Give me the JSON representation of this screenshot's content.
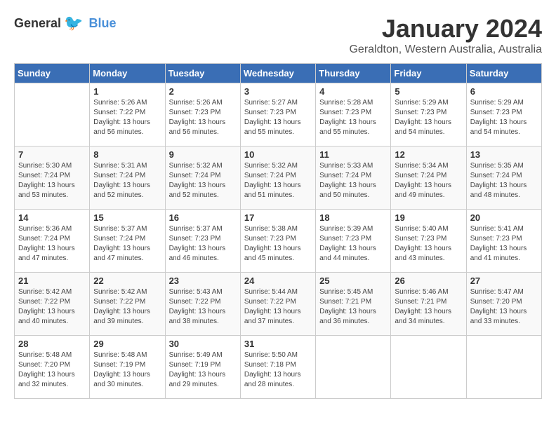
{
  "header": {
    "logo_general": "General",
    "logo_blue": "Blue",
    "month_year": "January 2024",
    "location": "Geraldton, Western Australia, Australia"
  },
  "days_of_week": [
    "Sunday",
    "Monday",
    "Tuesday",
    "Wednesday",
    "Thursday",
    "Friday",
    "Saturday"
  ],
  "weeks": [
    [
      {
        "day": "",
        "details": ""
      },
      {
        "day": "1",
        "details": "Sunrise: 5:26 AM\nSunset: 7:22 PM\nDaylight: 13 hours\nand 56 minutes."
      },
      {
        "day": "2",
        "details": "Sunrise: 5:26 AM\nSunset: 7:23 PM\nDaylight: 13 hours\nand 56 minutes."
      },
      {
        "day": "3",
        "details": "Sunrise: 5:27 AM\nSunset: 7:23 PM\nDaylight: 13 hours\nand 55 minutes."
      },
      {
        "day": "4",
        "details": "Sunrise: 5:28 AM\nSunset: 7:23 PM\nDaylight: 13 hours\nand 55 minutes."
      },
      {
        "day": "5",
        "details": "Sunrise: 5:29 AM\nSunset: 7:23 PM\nDaylight: 13 hours\nand 54 minutes."
      },
      {
        "day": "6",
        "details": "Sunrise: 5:29 AM\nSunset: 7:23 PM\nDaylight: 13 hours\nand 54 minutes."
      }
    ],
    [
      {
        "day": "7",
        "details": "Sunrise: 5:30 AM\nSunset: 7:24 PM\nDaylight: 13 hours\nand 53 minutes."
      },
      {
        "day": "8",
        "details": "Sunrise: 5:31 AM\nSunset: 7:24 PM\nDaylight: 13 hours\nand 52 minutes."
      },
      {
        "day": "9",
        "details": "Sunrise: 5:32 AM\nSunset: 7:24 PM\nDaylight: 13 hours\nand 52 minutes."
      },
      {
        "day": "10",
        "details": "Sunrise: 5:32 AM\nSunset: 7:24 PM\nDaylight: 13 hours\nand 51 minutes."
      },
      {
        "day": "11",
        "details": "Sunrise: 5:33 AM\nSunset: 7:24 PM\nDaylight: 13 hours\nand 50 minutes."
      },
      {
        "day": "12",
        "details": "Sunrise: 5:34 AM\nSunset: 7:24 PM\nDaylight: 13 hours\nand 49 minutes."
      },
      {
        "day": "13",
        "details": "Sunrise: 5:35 AM\nSunset: 7:24 PM\nDaylight: 13 hours\nand 48 minutes."
      }
    ],
    [
      {
        "day": "14",
        "details": "Sunrise: 5:36 AM\nSunset: 7:24 PM\nDaylight: 13 hours\nand 47 minutes."
      },
      {
        "day": "15",
        "details": "Sunrise: 5:37 AM\nSunset: 7:24 PM\nDaylight: 13 hours\nand 47 minutes."
      },
      {
        "day": "16",
        "details": "Sunrise: 5:37 AM\nSunset: 7:23 PM\nDaylight: 13 hours\nand 46 minutes."
      },
      {
        "day": "17",
        "details": "Sunrise: 5:38 AM\nSunset: 7:23 PM\nDaylight: 13 hours\nand 45 minutes."
      },
      {
        "day": "18",
        "details": "Sunrise: 5:39 AM\nSunset: 7:23 PM\nDaylight: 13 hours\nand 44 minutes."
      },
      {
        "day": "19",
        "details": "Sunrise: 5:40 AM\nSunset: 7:23 PM\nDaylight: 13 hours\nand 43 minutes."
      },
      {
        "day": "20",
        "details": "Sunrise: 5:41 AM\nSunset: 7:23 PM\nDaylight: 13 hours\nand 41 minutes."
      }
    ],
    [
      {
        "day": "21",
        "details": "Sunrise: 5:42 AM\nSunset: 7:22 PM\nDaylight: 13 hours\nand 40 minutes."
      },
      {
        "day": "22",
        "details": "Sunrise: 5:42 AM\nSunset: 7:22 PM\nDaylight: 13 hours\nand 39 minutes."
      },
      {
        "day": "23",
        "details": "Sunrise: 5:43 AM\nSunset: 7:22 PM\nDaylight: 13 hours\nand 38 minutes."
      },
      {
        "day": "24",
        "details": "Sunrise: 5:44 AM\nSunset: 7:22 PM\nDaylight: 13 hours\nand 37 minutes."
      },
      {
        "day": "25",
        "details": "Sunrise: 5:45 AM\nSunset: 7:21 PM\nDaylight: 13 hours\nand 36 minutes."
      },
      {
        "day": "26",
        "details": "Sunrise: 5:46 AM\nSunset: 7:21 PM\nDaylight: 13 hours\nand 34 minutes."
      },
      {
        "day": "27",
        "details": "Sunrise: 5:47 AM\nSunset: 7:20 PM\nDaylight: 13 hours\nand 33 minutes."
      }
    ],
    [
      {
        "day": "28",
        "details": "Sunrise: 5:48 AM\nSunset: 7:20 PM\nDaylight: 13 hours\nand 32 minutes."
      },
      {
        "day": "29",
        "details": "Sunrise: 5:48 AM\nSunset: 7:19 PM\nDaylight: 13 hours\nand 30 minutes."
      },
      {
        "day": "30",
        "details": "Sunrise: 5:49 AM\nSunset: 7:19 PM\nDaylight: 13 hours\nand 29 minutes."
      },
      {
        "day": "31",
        "details": "Sunrise: 5:50 AM\nSunset: 7:18 PM\nDaylight: 13 hours\nand 28 minutes."
      },
      {
        "day": "",
        "details": ""
      },
      {
        "day": "",
        "details": ""
      },
      {
        "day": "",
        "details": ""
      }
    ]
  ]
}
